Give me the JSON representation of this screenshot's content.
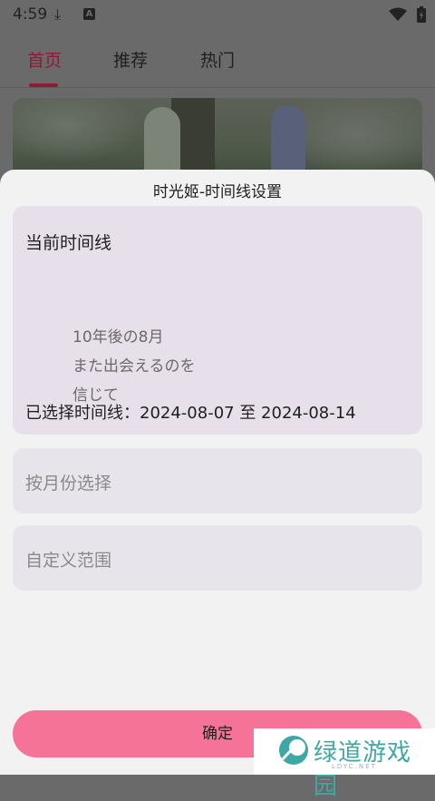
{
  "status_bar": {
    "time": "4:59",
    "icons": [
      "download-icon",
      "a-icon",
      "wifi-icon",
      "battery-icon"
    ]
  },
  "tabs": [
    {
      "label": "首页",
      "active": true
    },
    {
      "label": "推荐",
      "active": false
    },
    {
      "label": "热门",
      "active": false
    }
  ],
  "sheet": {
    "title": "时光姬-时间线设置",
    "current": {
      "heading": "当前时间线",
      "quote_lines": [
        "10年後の8月",
        "また出会えるのを",
        "信じて"
      ],
      "selected_range": "已选择时间线：2024-08-07 至 2024-08-14"
    },
    "options": [
      {
        "label": "按月份选择"
      },
      {
        "label": "自定义范围"
      }
    ],
    "confirm_label": "确定"
  },
  "watermark": {
    "text": "绿道游戏园",
    "sub": "LDYC.NET"
  },
  "colors": {
    "accent": "#8a1c35",
    "confirm_button": "#f57397",
    "card_bg": "#e7dfea",
    "option_bg": "#e7e4eb",
    "sheet_bg": "#f2f2f2",
    "scrim": "#6a6a6a",
    "watermark_teal": "#3fa8a4"
  }
}
